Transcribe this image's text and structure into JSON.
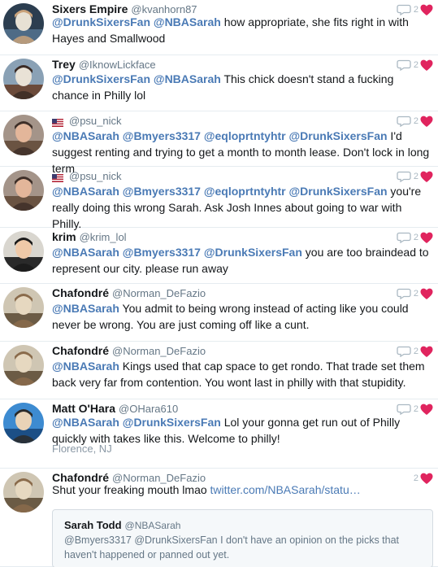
{
  "tweets": [
    {
      "name": "Sixers Empire",
      "handle": "@kvanhorn87",
      "reply_count": "2",
      "segments": [
        {
          "t": "@DrunkSixersFan",
          "m": true
        },
        {
          "t": " "
        },
        {
          "t": "@NBASarah",
          "m": true
        },
        {
          "t": " how appropriate, she fits right in with Hayes and Smallwood"
        }
      ]
    },
    {
      "name": "Trey",
      "handle": "@IknowLickface",
      "reply_count": "2",
      "segments": [
        {
          "t": "@DrunkSixersFan",
          "m": true
        },
        {
          "t": " "
        },
        {
          "t": "@NBASarah",
          "m": true
        },
        {
          "t": " This chick doesn't stand a fucking chance in Philly lol"
        }
      ]
    },
    {
      "name": "",
      "handle": "@psu_nick",
      "flag": true,
      "reply_count": "2",
      "segments": [
        {
          "t": "@NBASarah",
          "m": true
        },
        {
          "t": " "
        },
        {
          "t": "@Bmyers3317",
          "m": true
        },
        {
          "t": " "
        },
        {
          "t": "@eqloprtntyhtr",
          "m": true
        },
        {
          "t": " "
        },
        {
          "t": "@DrunkSixersFan",
          "m": true
        },
        {
          "t": " I'd suggest renting and trying to get a month to month lease. Don't lock in long term"
        }
      ]
    },
    {
      "name": "",
      "handle": "@psu_nick",
      "flag": true,
      "reply_count": "2",
      "segments": [
        {
          "t": "@NBASarah",
          "m": true
        },
        {
          "t": " "
        },
        {
          "t": "@Bmyers3317",
          "m": true
        },
        {
          "t": " "
        },
        {
          "t": "@eqloprtntyhtr",
          "m": true
        },
        {
          "t": " "
        },
        {
          "t": "@DrunkSixersFan",
          "m": true
        },
        {
          "t": " you're really doing this wrong Sarah. Ask Josh Innes about going to war with Philly."
        }
      ]
    },
    {
      "name": "krim",
      "handle": "@krim_lol",
      "reply_count": "2",
      "segments": [
        {
          "t": "@NBASarah",
          "m": true
        },
        {
          "t": " "
        },
        {
          "t": "@Bmyers3317",
          "m": true
        },
        {
          "t": " "
        },
        {
          "t": "@DrunkSixersFan",
          "m": true
        },
        {
          "t": " you are too braindead to represent our city. please run away"
        }
      ]
    },
    {
      "name": "Chafondré",
      "handle": "@Norman_DeFazio",
      "reply_count": "2",
      "segments": [
        {
          "t": "@NBASarah",
          "m": true
        },
        {
          "t": " You admit to being wrong instead of acting like you could never be wrong. You are just coming off like a cunt."
        }
      ]
    },
    {
      "name": "Chafondré",
      "handle": "@Norman_DeFazio",
      "reply_count": "2",
      "segments": [
        {
          "t": "@NBASarah",
          "m": true
        },
        {
          "t": " Kings used that cap space to get rondo. That trade set them back very far from contention. You wont last in philly with that stupidity."
        }
      ]
    },
    {
      "name": "Matt O'Hara",
      "handle": "@OHara610",
      "reply_count": "2",
      "location": "Florence, NJ",
      "segments": [
        {
          "t": "@NBASarah",
          "m": true
        },
        {
          "t": " "
        },
        {
          "t": "@DrunkSixersFan",
          "m": true
        },
        {
          "t": " Lol your gonna get run out of Philly quickly with takes like this. Welcome to philly!"
        }
      ]
    },
    {
      "name": "Chafondré",
      "handle": "@Norman_DeFazio",
      "reply_count": "2",
      "segments": [
        {
          "t": "Shut your freaking mouth lmao "
        },
        {
          "t": "twitter.com/NBASarah/statu…",
          "l": true
        }
      ],
      "quote": {
        "name": "Sarah Todd",
        "handle": "@NBASarah",
        "text": "@Bmyers3317 @DrunkSixersFan I don't have an opinion on the picks that haven't happened or panned out yet."
      }
    }
  ],
  "icons": {
    "reply": "reply-icon",
    "like": "heart-icon",
    "flag": "us-flag-icon"
  },
  "colors": {
    "mention": "#4a7ab5",
    "heart": "#e0245e",
    "meta": "#657786"
  }
}
